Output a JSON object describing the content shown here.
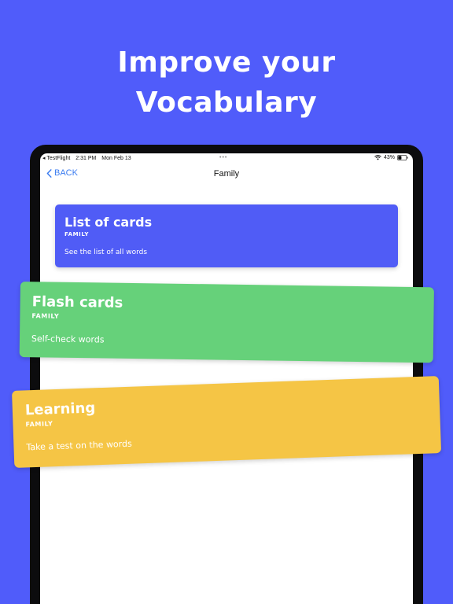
{
  "headline": {
    "line1": "Improve your",
    "line2": "Vocabulary"
  },
  "statusbar": {
    "back_app": "◂ TestFlight",
    "time": "2:31 PM",
    "date": "Mon Feb 13",
    "multitask_dots": "•••",
    "battery_percent": "43%",
    "battery_level": 0.43
  },
  "navbar": {
    "back_label": "BACK",
    "title": "Family"
  },
  "cards": {
    "list": {
      "title": "List of cards",
      "subtitle": "FAMILY",
      "description": "See the list of all words",
      "color": "#505cf6"
    },
    "flash": {
      "title": "Flash cards",
      "subtitle": "FAMILY",
      "description": "Self-check words",
      "color": "#66d17a"
    },
    "learning": {
      "title": "Learning",
      "subtitle": "FAMILY",
      "description": "Take a test on the words",
      "color": "#f5c545"
    }
  },
  "colors": {
    "background": "#505cfa",
    "accent_link": "#3b7cf0"
  },
  "icons": [
    "chevron-left-icon",
    "wifi-icon",
    "battery-icon"
  ]
}
